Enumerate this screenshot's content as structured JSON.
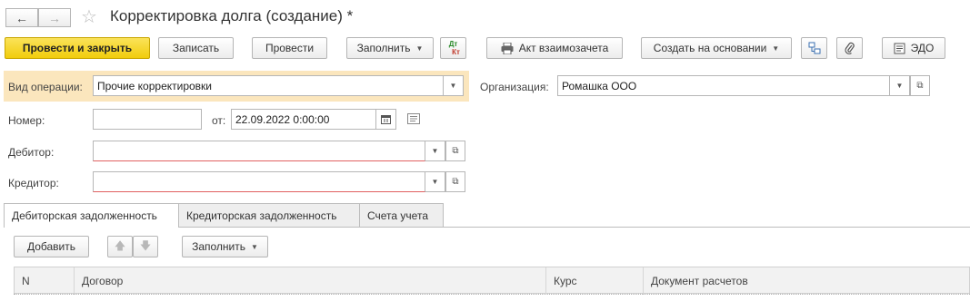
{
  "window": {
    "title": "Корректировка долга (создание) *"
  },
  "toolbar": {
    "post_and_close": "Провести и закрыть",
    "save": "Записать",
    "post": "Провести",
    "fill": "Заполнить",
    "dtkt_top": "Дт",
    "dtkt_bottom": "Кт",
    "offset_act": "Акт взаимозачета",
    "create_based_on": "Создать на основании",
    "edo": "ЭДО"
  },
  "form": {
    "operation_label": "Вид операции:",
    "operation_value": "Прочие корректировки",
    "organization_label": "Организация:",
    "organization_value": "Ромашка ООО",
    "number_label": "Номер:",
    "number_value": "",
    "date_from_label": "от:",
    "date_value": "22.09.2022  0:00:00",
    "debtor_label": "Дебитор:",
    "debtor_value": "",
    "creditor_label": "Кредитор:",
    "creditor_value": ""
  },
  "tabs": [
    {
      "label": "Дебиторская задолженность",
      "active": true
    },
    {
      "label": "Кредиторская задолженность",
      "active": false
    },
    {
      "label": "Счета учета",
      "active": false
    }
  ],
  "table_toolbar": {
    "add": "Добавить",
    "fill": "Заполнить"
  },
  "table": {
    "columns": [
      "N",
      "Договор",
      "Курс",
      "Документ расчетов"
    ]
  },
  "icons": {
    "back": "arrow-left-icon",
    "forward": "arrow-right-icon",
    "favorite": "star-icon",
    "print": "printer-icon",
    "structure": "structure-icon",
    "attach": "paperclip-icon",
    "edo": "edo-icon",
    "calendar": "calendar-icon",
    "history": "history-icon",
    "move_up": "arrow-up-icon",
    "move_down": "arrow-down-icon",
    "open": "open-icon"
  },
  "colors": {
    "primary_button": "#f5d31d",
    "operation_highlight": "#fbe6bd",
    "required_underline": "#e06060"
  }
}
